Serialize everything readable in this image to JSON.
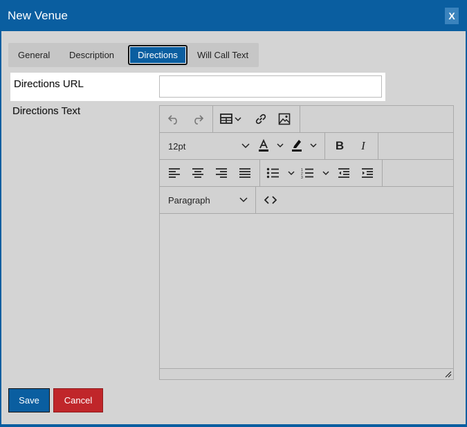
{
  "dialog": {
    "title": "New Venue",
    "close_label": "X"
  },
  "tabs": [
    {
      "label": "General",
      "active": false
    },
    {
      "label": "Description",
      "active": false
    },
    {
      "label": "Directions",
      "active": true
    },
    {
      "label": "Will Call Text",
      "active": false
    }
  ],
  "form": {
    "directions_url_label": "Directions URL",
    "directions_url_value": "",
    "directions_text_label": "Directions Text"
  },
  "editor": {
    "toolbar": {
      "row1": [
        "undo-icon",
        "redo-icon",
        "table-icon",
        "link-icon",
        "image-icon"
      ],
      "font_size": "12pt",
      "row2_icons": [
        "font-color-icon",
        "highlight-color-icon",
        "bold-icon",
        "italic-icon"
      ],
      "row3_icons": [
        "align-left-icon",
        "align-center-icon",
        "align-right-icon",
        "align-justify-icon",
        "bullet-list-icon",
        "numbered-list-icon",
        "outdent-icon",
        "indent-icon"
      ],
      "block_format": "Paragraph",
      "row4_icons": [
        "source-code-icon"
      ]
    },
    "content": ""
  },
  "buttons": {
    "save": "Save",
    "cancel": "Cancel"
  },
  "colors": {
    "primary": "#0a5ea0",
    "danger": "#c0262a",
    "background": "#d4d4d4"
  }
}
